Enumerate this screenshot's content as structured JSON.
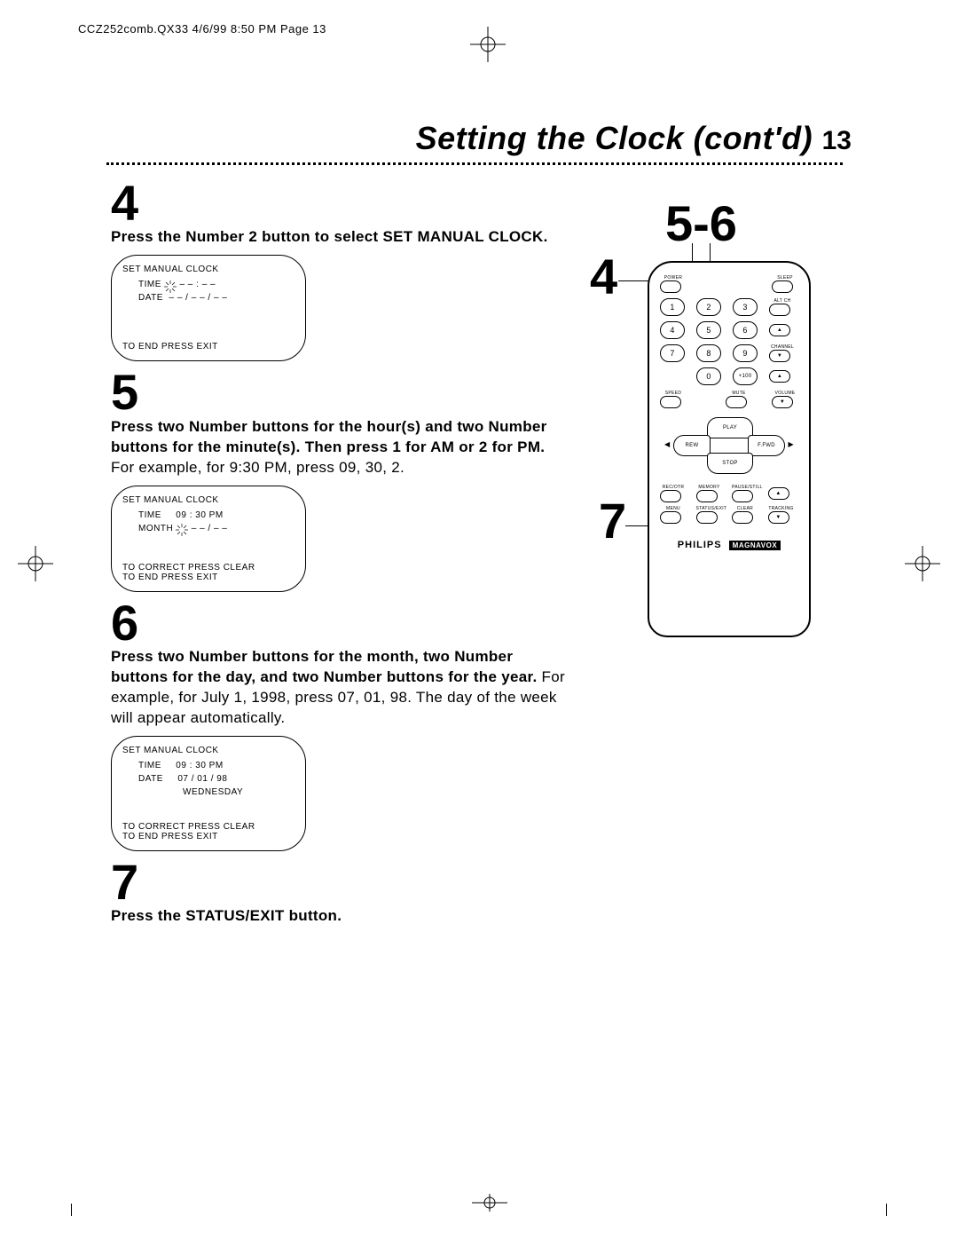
{
  "meta": {
    "header": "CCZ252comb.QX33  4/6/99 8:50 PM  Page 13"
  },
  "title": {
    "text": "Setting the Clock (cont'd)",
    "page": "13"
  },
  "steps": {
    "s4": {
      "num": "4",
      "bold": "Press the Number 2 button to select SET MANUAL CLOCK."
    },
    "s5": {
      "num": "5",
      "bold": "Press two Number buttons for the hour(s) and two Number buttons for the minute(s). Then press 1 for AM or 2 for PM.",
      "rest": " For example, for 9:30 PM, press 09, 30, 2."
    },
    "s6": {
      "num": "6",
      "bold": "Press two Number buttons for the month, two Number buttons for the day, and two Number buttons for the year.",
      "rest": " For example, for July 1, 1998, press 07, 01, 98. The day of the week will appear automatically."
    },
    "s7": {
      "num": "7",
      "bold": "Press the STATUS/EXIT button."
    }
  },
  "osd1": {
    "title": "SET MANUAL CLOCK",
    "time_label": "TIME",
    "time_value": "– – : – –",
    "date_label": "DATE",
    "date_value": "– – / – – / – –",
    "foot": "TO END PRESS EXIT"
  },
  "osd2": {
    "title": "SET MANUAL CLOCK",
    "time_label": "TIME",
    "time_value": "09 : 30 PM",
    "month_label": "MONTH",
    "month_value": "– – / – –",
    "foot1": "TO CORRECT PRESS CLEAR",
    "foot2": "TO END PRESS EXIT"
  },
  "osd3": {
    "title": "SET MANUAL CLOCK",
    "time_label": "TIME",
    "time_value": "09 : 30 PM",
    "date_label": "DATE",
    "date_value": "07 / 01 / 98",
    "dow": "WEDNESDAY",
    "foot1": "TO CORRECT PRESS CLEAR",
    "foot2": "TO END PRESS EXIT"
  },
  "callouts": {
    "c56": "5-6",
    "c4": "4",
    "c7": "7"
  },
  "remote": {
    "power": "POWER",
    "sleep": "SLEEP",
    "altch": "ALT CH",
    "nums": [
      "1",
      "2",
      "3",
      "4",
      "5",
      "6",
      "7",
      "8",
      "9",
      "0",
      "+100"
    ],
    "channel": "CHANNEL",
    "speed": "SPEED",
    "mute": "MUTE",
    "volume": "VOLUME",
    "play": "PLAY",
    "rew": "REW",
    "ffwd": "F.FWD",
    "stop": "STOP",
    "rec": "REC/OTR",
    "memory": "MEMORY",
    "pause": "PAUSE/STILL",
    "menu": "MENU",
    "status": "STATUS/EXIT",
    "clear": "CLEAR",
    "tracking": "TRACKING",
    "up": "▲",
    "down": "▼",
    "plus": "+",
    "brand1": "PHILIPS",
    "brand2": "MAGNAVOX"
  }
}
